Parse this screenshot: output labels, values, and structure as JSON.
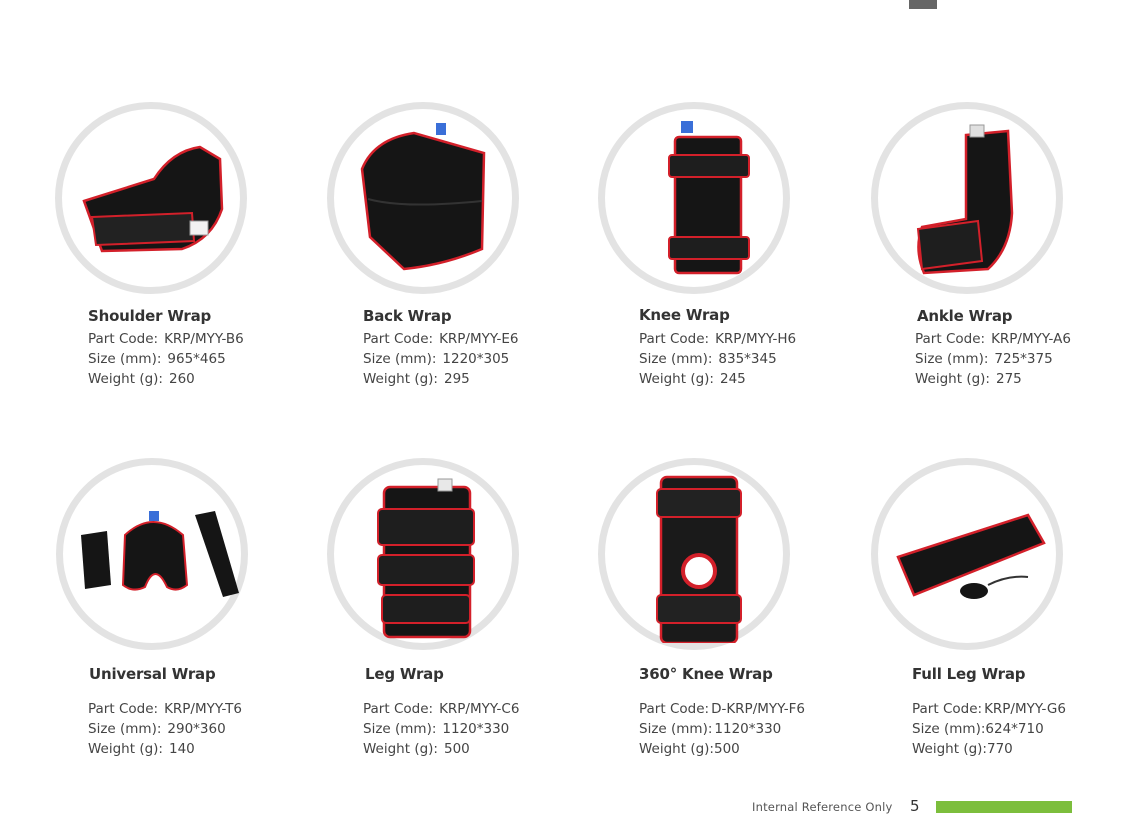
{
  "products": [
    {
      "name": "Shoulder Wrap",
      "part_label": "Part Code:",
      "part": "KRP/MYY-B6",
      "size_label": "Size (mm):",
      "size": "965*465",
      "weight_label": "Weight (g):",
      "weight": "260",
      "icon": "shoulder-wrap-image"
    },
    {
      "name": "Back Wrap",
      "part_label": "Part Code:",
      "part": "KRP/MYY-E6",
      "size_label": "Size (mm):",
      "size": "1220*305",
      "weight_label": "Weight (g):",
      "weight": "295",
      "icon": "back-wrap-image"
    },
    {
      "name": "Knee Wrap",
      "part_label": "Part Code:",
      "part": "KRP/MYY-H6",
      "size_label": "Size (mm):",
      "size": "835*345",
      "weight_label": "Weight (g):",
      "weight": "245",
      "icon": "knee-wrap-image"
    },
    {
      "name": "Ankle Wrap",
      "part_label": "Part Code:",
      "part": "KRP/MYY-A6",
      "size_label": "Size (mm):",
      "size": "725*375",
      "weight_label": "Weight (g):",
      "weight": "275",
      "icon": "ankle-wrap-image"
    },
    {
      "name": "Universal Wrap",
      "part_label": "Part Code:",
      "part": "KRP/MYY-T6",
      "size_label": "Size (mm):",
      "size": "290*360",
      "weight_label": "Weight (g):",
      "weight": "140",
      "icon": "universal-wrap-image"
    },
    {
      "name": "Leg Wrap",
      "part_label": "Part Code:",
      "part": "KRP/MYY-C6",
      "size_label": "Size (mm):",
      "size": "1120*330",
      "weight_label": "Weight (g):",
      "weight": "500",
      "icon": "leg-wrap-image"
    },
    {
      "name": "360° Knee Wrap",
      "part_label": "Part Code:",
      "part": "D-KRP/MYY-F6",
      "size_label": "Size (mm):",
      "size": "1120*330",
      "weight_label": "Weight (g):",
      "weight": "500",
      "icon": "360-knee-wrap-image"
    },
    {
      "name": "Full Leg Wrap",
      "part_label": "Part Code:",
      "part": "KRP/MYY-G6",
      "size_label": "Size (mm):",
      "size": "624*710",
      "weight_label": "Weight (g):",
      "weight": "770",
      "icon": "full-leg-wrap-image"
    }
  ],
  "footer": {
    "note": "Internal Reference Only",
    "page_number": "5"
  },
  "colors": {
    "wrap_black": "#151515",
    "trim_red": "#d3202a",
    "circle_border": "#e3e3e3",
    "footer_bar": "#7cbe3c",
    "corner_mark": "#666666"
  }
}
